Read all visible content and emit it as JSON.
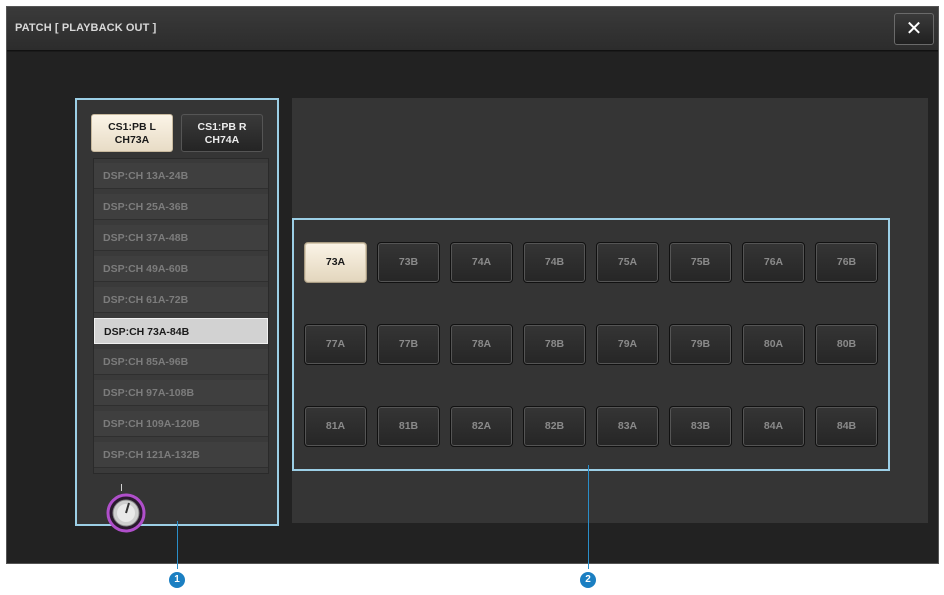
{
  "window": {
    "title": "PATCH [ PLAYBACK OUT ]",
    "close_symbol": "✕"
  },
  "pb_buttons": [
    {
      "line1": "CS1:PB L",
      "line2": "CH73A",
      "selected": true
    },
    {
      "line1": "CS1:PB R",
      "line2": "CH74A",
      "selected": false
    }
  ],
  "range_list": [
    "DSP:CH 13A-24B",
    "DSP:CH 25A-36B",
    "DSP:CH 37A-48B",
    "DSP:CH 49A-60B",
    "DSP:CH 61A-72B",
    "DSP:CH 73A-84B",
    "DSP:CH 85A-96B",
    "DSP:CH 97A-108B",
    "DSP:CH 109A-120B",
    "DSP:CH 121A-132B"
  ],
  "range_selected_index": 5,
  "channels": [
    [
      "73A",
      "73B",
      "74A",
      "74B",
      "75A",
      "75B",
      "76A",
      "76B"
    ],
    [
      "77A",
      "77B",
      "78A",
      "78B",
      "79A",
      "79B",
      "80A",
      "80B"
    ],
    [
      "81A",
      "81B",
      "82A",
      "82B",
      "83A",
      "83B",
      "84A",
      "84B"
    ]
  ],
  "channel_selected": "73A",
  "callouts": [
    "1",
    "2"
  ],
  "colors": {
    "highlight_border": "#9ccfe6",
    "callout": "#1b7fc2",
    "knob_ring": "#a246b8",
    "selected_button": "#f6eedf"
  },
  "icons": {
    "close": "close-icon",
    "knob": "scroll-knob-icon"
  }
}
